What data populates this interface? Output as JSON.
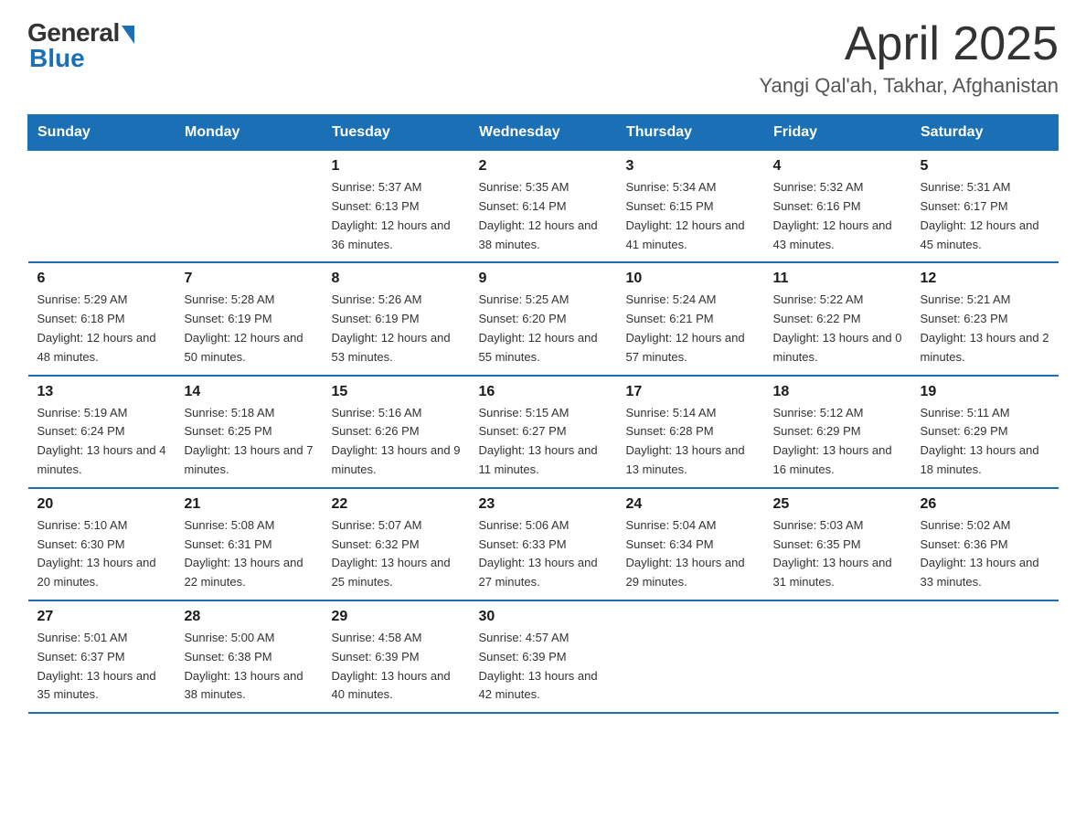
{
  "header": {
    "logo": {
      "general": "General",
      "blue": "Blue"
    },
    "title": "April 2025",
    "location": "Yangi Qal'ah, Takhar, Afghanistan"
  },
  "days_of_week": [
    "Sunday",
    "Monday",
    "Tuesday",
    "Wednesday",
    "Thursday",
    "Friday",
    "Saturday"
  ],
  "weeks": [
    [
      {
        "day": "",
        "sunrise": "",
        "sunset": "",
        "daylight": ""
      },
      {
        "day": "",
        "sunrise": "",
        "sunset": "",
        "daylight": ""
      },
      {
        "day": "1",
        "sunrise": "Sunrise: 5:37 AM",
        "sunset": "Sunset: 6:13 PM",
        "daylight": "Daylight: 12 hours and 36 minutes."
      },
      {
        "day": "2",
        "sunrise": "Sunrise: 5:35 AM",
        "sunset": "Sunset: 6:14 PM",
        "daylight": "Daylight: 12 hours and 38 minutes."
      },
      {
        "day": "3",
        "sunrise": "Sunrise: 5:34 AM",
        "sunset": "Sunset: 6:15 PM",
        "daylight": "Daylight: 12 hours and 41 minutes."
      },
      {
        "day": "4",
        "sunrise": "Sunrise: 5:32 AM",
        "sunset": "Sunset: 6:16 PM",
        "daylight": "Daylight: 12 hours and 43 minutes."
      },
      {
        "day": "5",
        "sunrise": "Sunrise: 5:31 AM",
        "sunset": "Sunset: 6:17 PM",
        "daylight": "Daylight: 12 hours and 45 minutes."
      }
    ],
    [
      {
        "day": "6",
        "sunrise": "Sunrise: 5:29 AM",
        "sunset": "Sunset: 6:18 PM",
        "daylight": "Daylight: 12 hours and 48 minutes."
      },
      {
        "day": "7",
        "sunrise": "Sunrise: 5:28 AM",
        "sunset": "Sunset: 6:19 PM",
        "daylight": "Daylight: 12 hours and 50 minutes."
      },
      {
        "day": "8",
        "sunrise": "Sunrise: 5:26 AM",
        "sunset": "Sunset: 6:19 PM",
        "daylight": "Daylight: 12 hours and 53 minutes."
      },
      {
        "day": "9",
        "sunrise": "Sunrise: 5:25 AM",
        "sunset": "Sunset: 6:20 PM",
        "daylight": "Daylight: 12 hours and 55 minutes."
      },
      {
        "day": "10",
        "sunrise": "Sunrise: 5:24 AM",
        "sunset": "Sunset: 6:21 PM",
        "daylight": "Daylight: 12 hours and 57 minutes."
      },
      {
        "day": "11",
        "sunrise": "Sunrise: 5:22 AM",
        "sunset": "Sunset: 6:22 PM",
        "daylight": "Daylight: 13 hours and 0 minutes."
      },
      {
        "day": "12",
        "sunrise": "Sunrise: 5:21 AM",
        "sunset": "Sunset: 6:23 PM",
        "daylight": "Daylight: 13 hours and 2 minutes."
      }
    ],
    [
      {
        "day": "13",
        "sunrise": "Sunrise: 5:19 AM",
        "sunset": "Sunset: 6:24 PM",
        "daylight": "Daylight: 13 hours and 4 minutes."
      },
      {
        "day": "14",
        "sunrise": "Sunrise: 5:18 AM",
        "sunset": "Sunset: 6:25 PM",
        "daylight": "Daylight: 13 hours and 7 minutes."
      },
      {
        "day": "15",
        "sunrise": "Sunrise: 5:16 AM",
        "sunset": "Sunset: 6:26 PM",
        "daylight": "Daylight: 13 hours and 9 minutes."
      },
      {
        "day": "16",
        "sunrise": "Sunrise: 5:15 AM",
        "sunset": "Sunset: 6:27 PM",
        "daylight": "Daylight: 13 hours and 11 minutes."
      },
      {
        "day": "17",
        "sunrise": "Sunrise: 5:14 AM",
        "sunset": "Sunset: 6:28 PM",
        "daylight": "Daylight: 13 hours and 13 minutes."
      },
      {
        "day": "18",
        "sunrise": "Sunrise: 5:12 AM",
        "sunset": "Sunset: 6:29 PM",
        "daylight": "Daylight: 13 hours and 16 minutes."
      },
      {
        "day": "19",
        "sunrise": "Sunrise: 5:11 AM",
        "sunset": "Sunset: 6:29 PM",
        "daylight": "Daylight: 13 hours and 18 minutes."
      }
    ],
    [
      {
        "day": "20",
        "sunrise": "Sunrise: 5:10 AM",
        "sunset": "Sunset: 6:30 PM",
        "daylight": "Daylight: 13 hours and 20 minutes."
      },
      {
        "day": "21",
        "sunrise": "Sunrise: 5:08 AM",
        "sunset": "Sunset: 6:31 PM",
        "daylight": "Daylight: 13 hours and 22 minutes."
      },
      {
        "day": "22",
        "sunrise": "Sunrise: 5:07 AM",
        "sunset": "Sunset: 6:32 PM",
        "daylight": "Daylight: 13 hours and 25 minutes."
      },
      {
        "day": "23",
        "sunrise": "Sunrise: 5:06 AM",
        "sunset": "Sunset: 6:33 PM",
        "daylight": "Daylight: 13 hours and 27 minutes."
      },
      {
        "day": "24",
        "sunrise": "Sunrise: 5:04 AM",
        "sunset": "Sunset: 6:34 PM",
        "daylight": "Daylight: 13 hours and 29 minutes."
      },
      {
        "day": "25",
        "sunrise": "Sunrise: 5:03 AM",
        "sunset": "Sunset: 6:35 PM",
        "daylight": "Daylight: 13 hours and 31 minutes."
      },
      {
        "day": "26",
        "sunrise": "Sunrise: 5:02 AM",
        "sunset": "Sunset: 6:36 PM",
        "daylight": "Daylight: 13 hours and 33 minutes."
      }
    ],
    [
      {
        "day": "27",
        "sunrise": "Sunrise: 5:01 AM",
        "sunset": "Sunset: 6:37 PM",
        "daylight": "Daylight: 13 hours and 35 minutes."
      },
      {
        "day": "28",
        "sunrise": "Sunrise: 5:00 AM",
        "sunset": "Sunset: 6:38 PM",
        "daylight": "Daylight: 13 hours and 38 minutes."
      },
      {
        "day": "29",
        "sunrise": "Sunrise: 4:58 AM",
        "sunset": "Sunset: 6:39 PM",
        "daylight": "Daylight: 13 hours and 40 minutes."
      },
      {
        "day": "30",
        "sunrise": "Sunrise: 4:57 AM",
        "sunset": "Sunset: 6:39 PM",
        "daylight": "Daylight: 13 hours and 42 minutes."
      },
      {
        "day": "",
        "sunrise": "",
        "sunset": "",
        "daylight": ""
      },
      {
        "day": "",
        "sunrise": "",
        "sunset": "",
        "daylight": ""
      },
      {
        "day": "",
        "sunrise": "",
        "sunset": "",
        "daylight": ""
      }
    ]
  ]
}
